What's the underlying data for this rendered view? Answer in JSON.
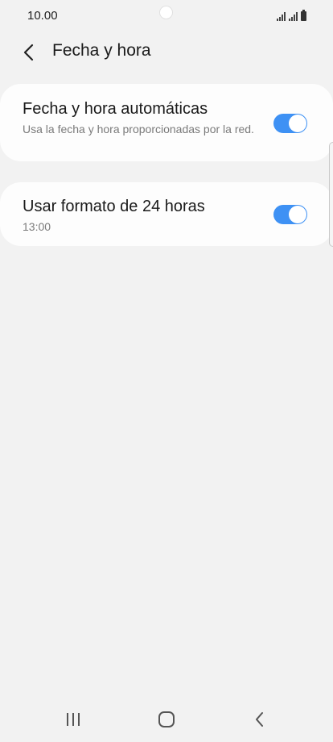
{
  "status_bar": {
    "time": "10.00",
    "icons": [
      "signal-icon",
      "signal-icon",
      "battery-icon"
    ]
  },
  "header": {
    "title": "Fecha y hora",
    "back_icon": "back-arrow-icon"
  },
  "settings": [
    {
      "title": "Fecha y hora automáticas",
      "subtitle": "Usa la fecha y hora proporcionadas por la red.",
      "enabled": true
    },
    {
      "title": "Usar formato de 24 horas",
      "subtitle": "13:00",
      "enabled": true
    }
  ],
  "colors": {
    "background": "#f2f2f2",
    "card": "#fdfdfd",
    "toggle_on": "#3e91f4"
  },
  "nav_bar": {
    "icons": [
      "recents-icon",
      "home-icon",
      "back-icon"
    ]
  }
}
